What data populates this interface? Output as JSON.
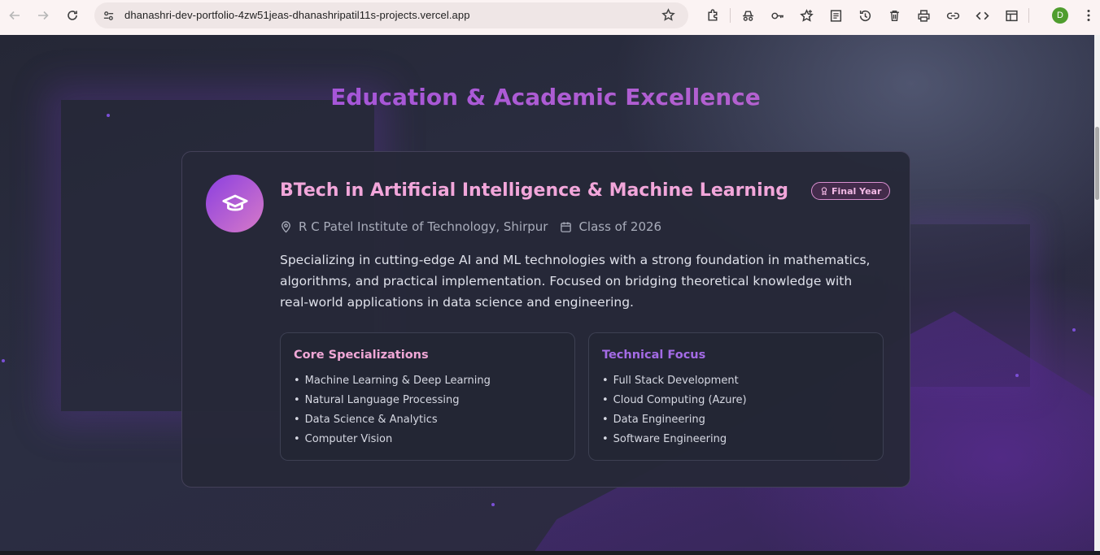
{
  "browser": {
    "url": "dhanashri-dev-portfolio-4zw51jeas-dhanashripatil11s-projects.vercel.app",
    "profile_initial": "D",
    "toolbar_icons": [
      "extensions-icon",
      "incognito-icon",
      "password-key-icon",
      "bookmarks-star-icon",
      "reading-list-icon",
      "history-icon",
      "delete-icon",
      "print-icon",
      "link-icon",
      "code-icon",
      "side-panel-icon"
    ]
  },
  "section": {
    "title": "Education & Academic Excellence"
  },
  "education": {
    "degree": "BTech in Artificial Intelligence & Machine Learning",
    "status": "Final Year",
    "institution": "R C Patel Institute of Technology, Shirpur",
    "class_of": "Class of 2026",
    "description": "Specializing in cutting-edge AI and ML technologies with a strong foundation in mathematics, algorithms, and practical implementation. Focused on bridging theoretical knowledge with real-world applications in data science and engineering.",
    "core": {
      "title": "Core Specializations",
      "items": [
        "Machine Learning & Deep Learning",
        "Natural Language Processing",
        "Data Science & Analytics",
        "Computer Vision"
      ]
    },
    "technical": {
      "title": "Technical Focus",
      "items": [
        "Full Stack Development",
        "Cloud Computing (Azure)",
        "Data Engineering",
        "Software Engineering"
      ]
    }
  },
  "colors": {
    "accent_pink": "#f2a6da",
    "accent_purple": "#a46be6",
    "card_bg": "#262938"
  }
}
